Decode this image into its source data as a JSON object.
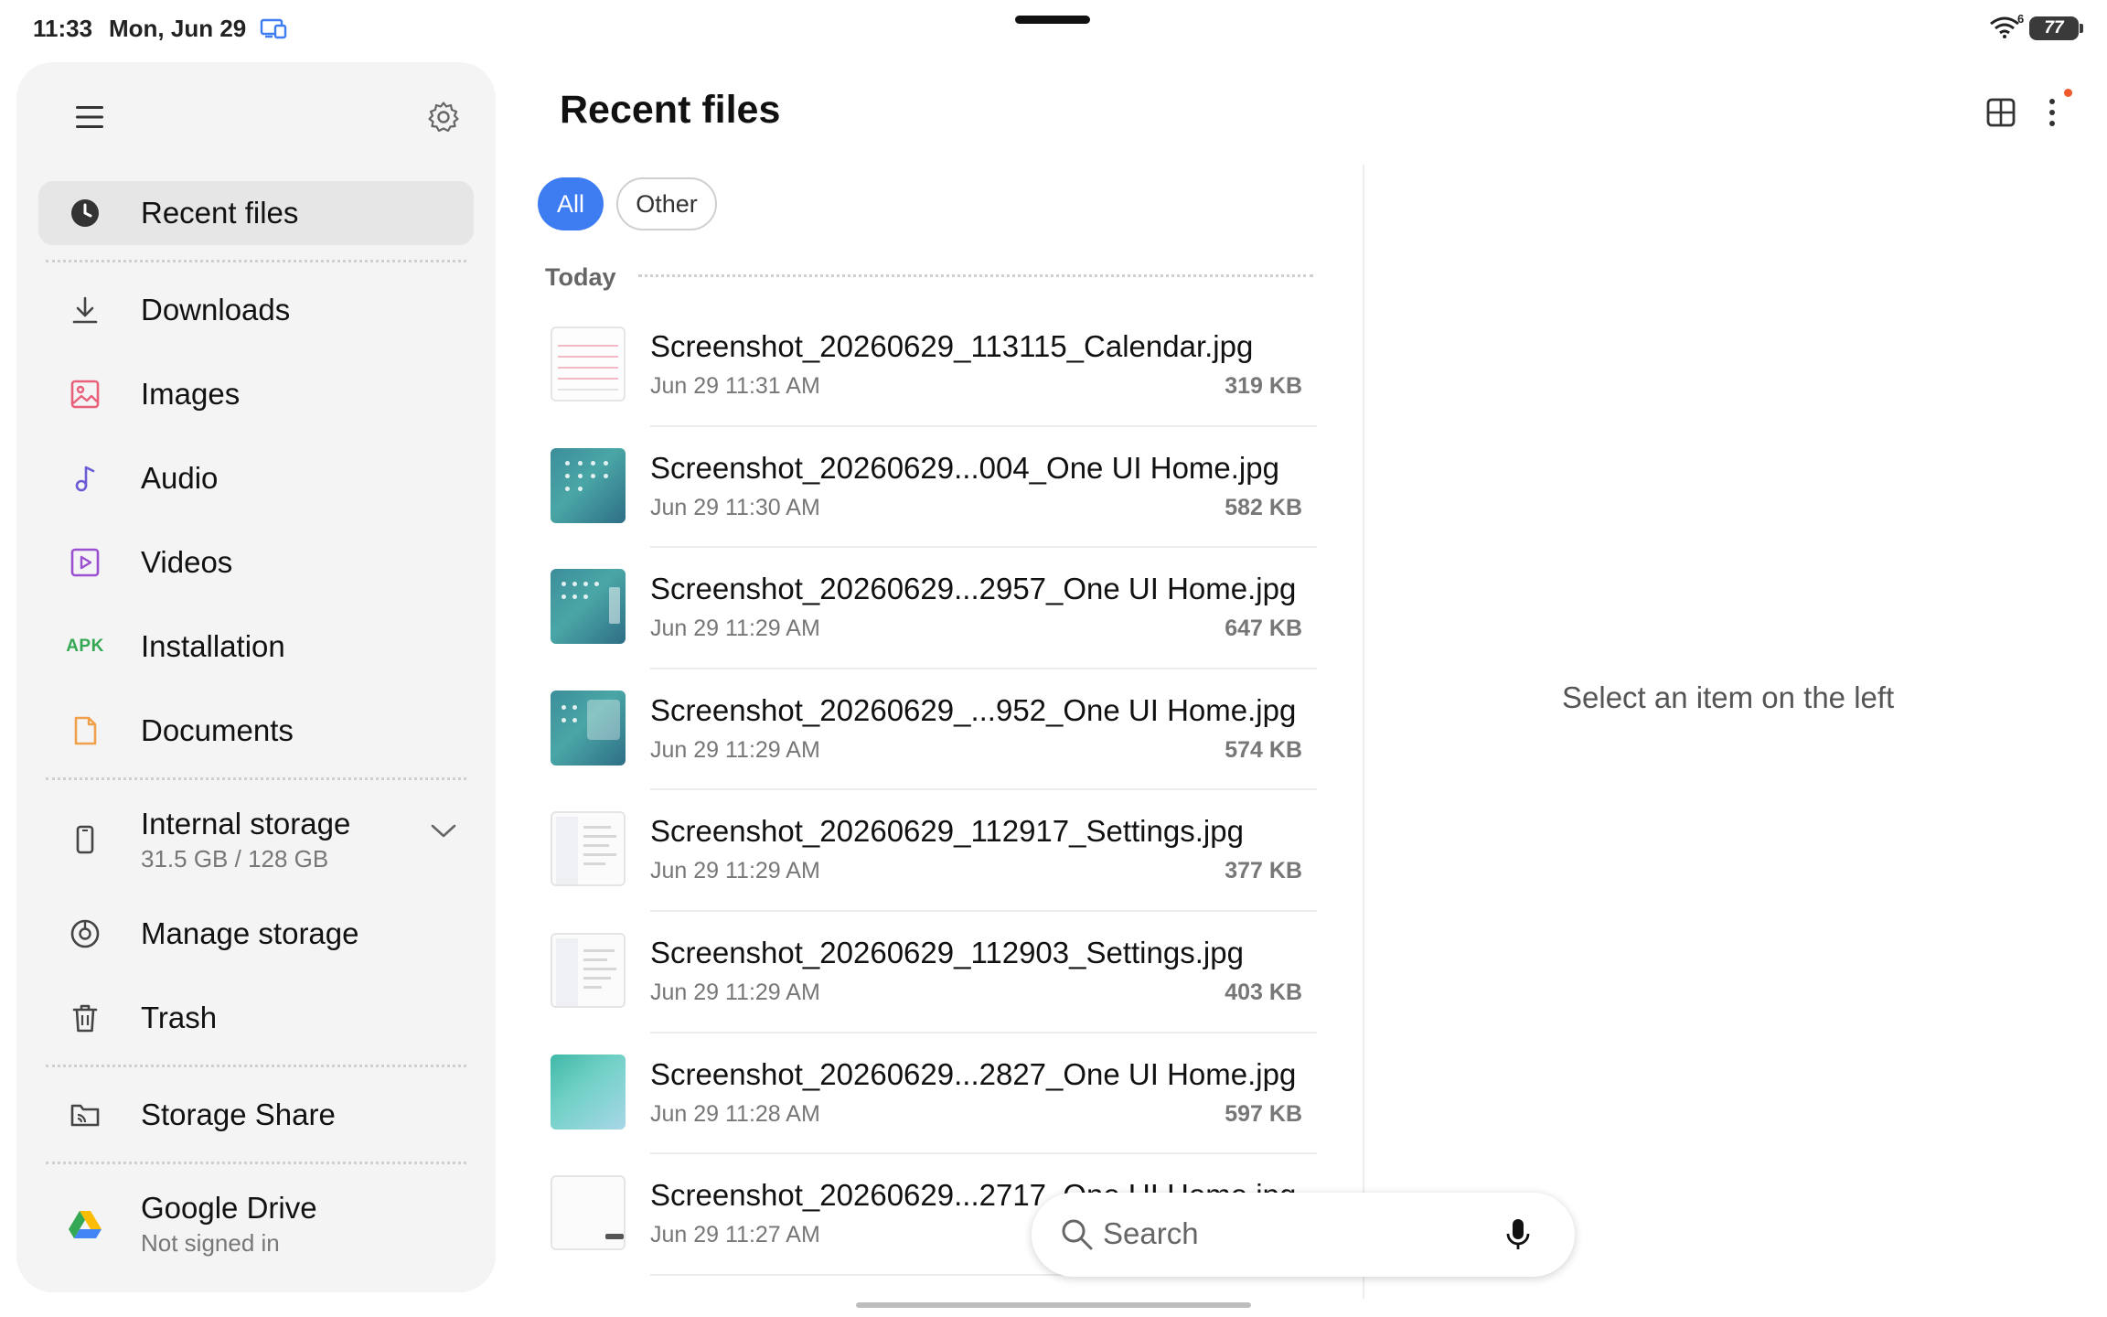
{
  "status_bar": {
    "time": "11:33",
    "date": "Mon, Jun 29",
    "wifi_label": "6",
    "battery_level": "77"
  },
  "sidebar": {
    "items": [
      {
        "label": "Recent files",
        "icon": "clock-icon",
        "active": true
      },
      {
        "label": "Downloads",
        "icon": "download-icon"
      },
      {
        "label": "Images",
        "icon": "image-icon"
      },
      {
        "label": "Audio",
        "icon": "music-note-icon"
      },
      {
        "label": "Videos",
        "icon": "video-icon"
      },
      {
        "label": "Installation",
        "icon": "apk-icon",
        "icon_text": "APK"
      },
      {
        "label": "Documents",
        "icon": "document-icon"
      },
      {
        "label": "Internal storage",
        "sub": "31.5 GB / 128 GB",
        "icon": "phone-icon"
      },
      {
        "label": "Manage storage",
        "icon": "storage-chart-icon"
      },
      {
        "label": "Trash",
        "icon": "trash-icon"
      },
      {
        "label": "Storage Share",
        "icon": "folder-cast-icon"
      },
      {
        "label": "Google Drive",
        "sub": "Not signed in",
        "icon": "google-drive-icon"
      }
    ]
  },
  "header": {
    "title": "Recent files"
  },
  "filters": [
    {
      "label": "All",
      "selected": true
    },
    {
      "label": "Other",
      "selected": false
    }
  ],
  "section_title": "Today",
  "files": [
    {
      "name": "Screenshot_20260629_113115_Calendar.jpg",
      "date": "Jun 29 11:31 AM",
      "size": "319 KB",
      "thumb": "calendar"
    },
    {
      "name": "Screenshot_20260629...004_One UI Home.jpg",
      "date": "Jun 29 11:30 AM",
      "size": "582 KB",
      "thumb": "home"
    },
    {
      "name": "Screenshot_20260629...2957_One UI Home.jpg",
      "date": "Jun 29 11:29 AM",
      "size": "647 KB",
      "thumb": "home"
    },
    {
      "name": "Screenshot_20260629_...952_One UI Home.jpg",
      "date": "Jun 29 11:29 AM",
      "size": "574 KB",
      "thumb": "home"
    },
    {
      "name": "Screenshot_20260629_112917_Settings.jpg",
      "date": "Jun 29 11:29 AM",
      "size": "377 KB",
      "thumb": "settings"
    },
    {
      "name": "Screenshot_20260629_112903_Settings.jpg",
      "date": "Jun 29 11:29 AM",
      "size": "403 KB",
      "thumb": "settings"
    },
    {
      "name": "Screenshot_20260629...2827_One UI Home.jpg",
      "date": "Jun 29 11:28 AM",
      "size": "597 KB",
      "thumb": "wallpaper"
    },
    {
      "name": "Screenshot_20260629...2717_One UI Home.jpg",
      "date": "Jun 29 11:27 AM",
      "size": "",
      "thumb": "blank"
    }
  ],
  "detail_pane": {
    "empty_message": "Select an item on the left"
  },
  "search": {
    "placeholder": "Search"
  },
  "colors": {
    "accent": "#3e7cf2",
    "notification_dot": "#ef5a2a",
    "apk_green": "#34a853"
  }
}
